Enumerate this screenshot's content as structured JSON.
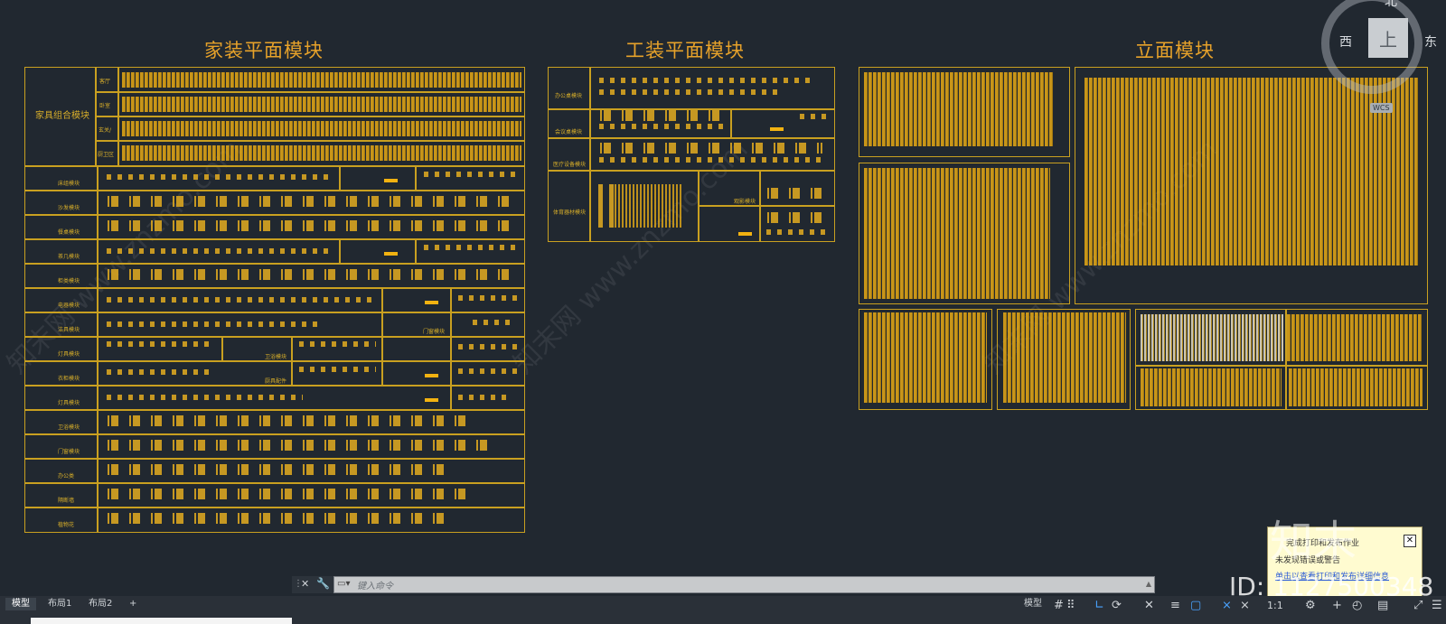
{
  "headings": {
    "home_plan": "家装平面模块",
    "office_plan": "工装平面模块",
    "elevation": "立面模块"
  },
  "home_table": {
    "group_title": "家具组合模块",
    "sub_rows": [
      "客厅",
      "卧室",
      "玄关/",
      "厨卫区"
    ],
    "rows": [
      "床组模块",
      "沙发模块",
      "餐桌模块",
      "茶几模块",
      "柜类模块",
      "电器模块",
      "洁具模块",
      "灯具模块",
      "衣柜模块",
      "灯具模块",
      "卫浴模块",
      "门窗模块",
      "办公类",
      "隔断墙",
      "植物花"
    ],
    "inline_labels": [
      "门窗模块",
      "卫浴模块",
      "厨具配件"
    ]
  },
  "office_table": {
    "rows": [
      "办公桌模块",
      "会议桌模块",
      "医疗设备模块",
      "体育器材模块"
    ],
    "inline_labels": [
      "观影模块"
    ]
  },
  "viewcube": {
    "north": "北",
    "west": "西",
    "east": "东",
    "face": "上",
    "wcs": "WCS"
  },
  "command": {
    "placeholder": "键入命令"
  },
  "tabs": [
    "模型",
    "布局1",
    "布局2",
    "+"
  ],
  "status": {
    "model_label": "模型",
    "scale": "1:1"
  },
  "notification": {
    "title": "完成打印和发布作业",
    "body": "未发现错误或警告",
    "link": "单击以查看打印和发布详细信息"
  },
  "overlay": {
    "logo": "知末",
    "id_text": "ID: 1127500348",
    "watermark": "知末网 www.znzmo.com"
  },
  "colors": {
    "background": "#212830",
    "cad_yellow": "#e7a22a",
    "frame": "#c9a020"
  }
}
